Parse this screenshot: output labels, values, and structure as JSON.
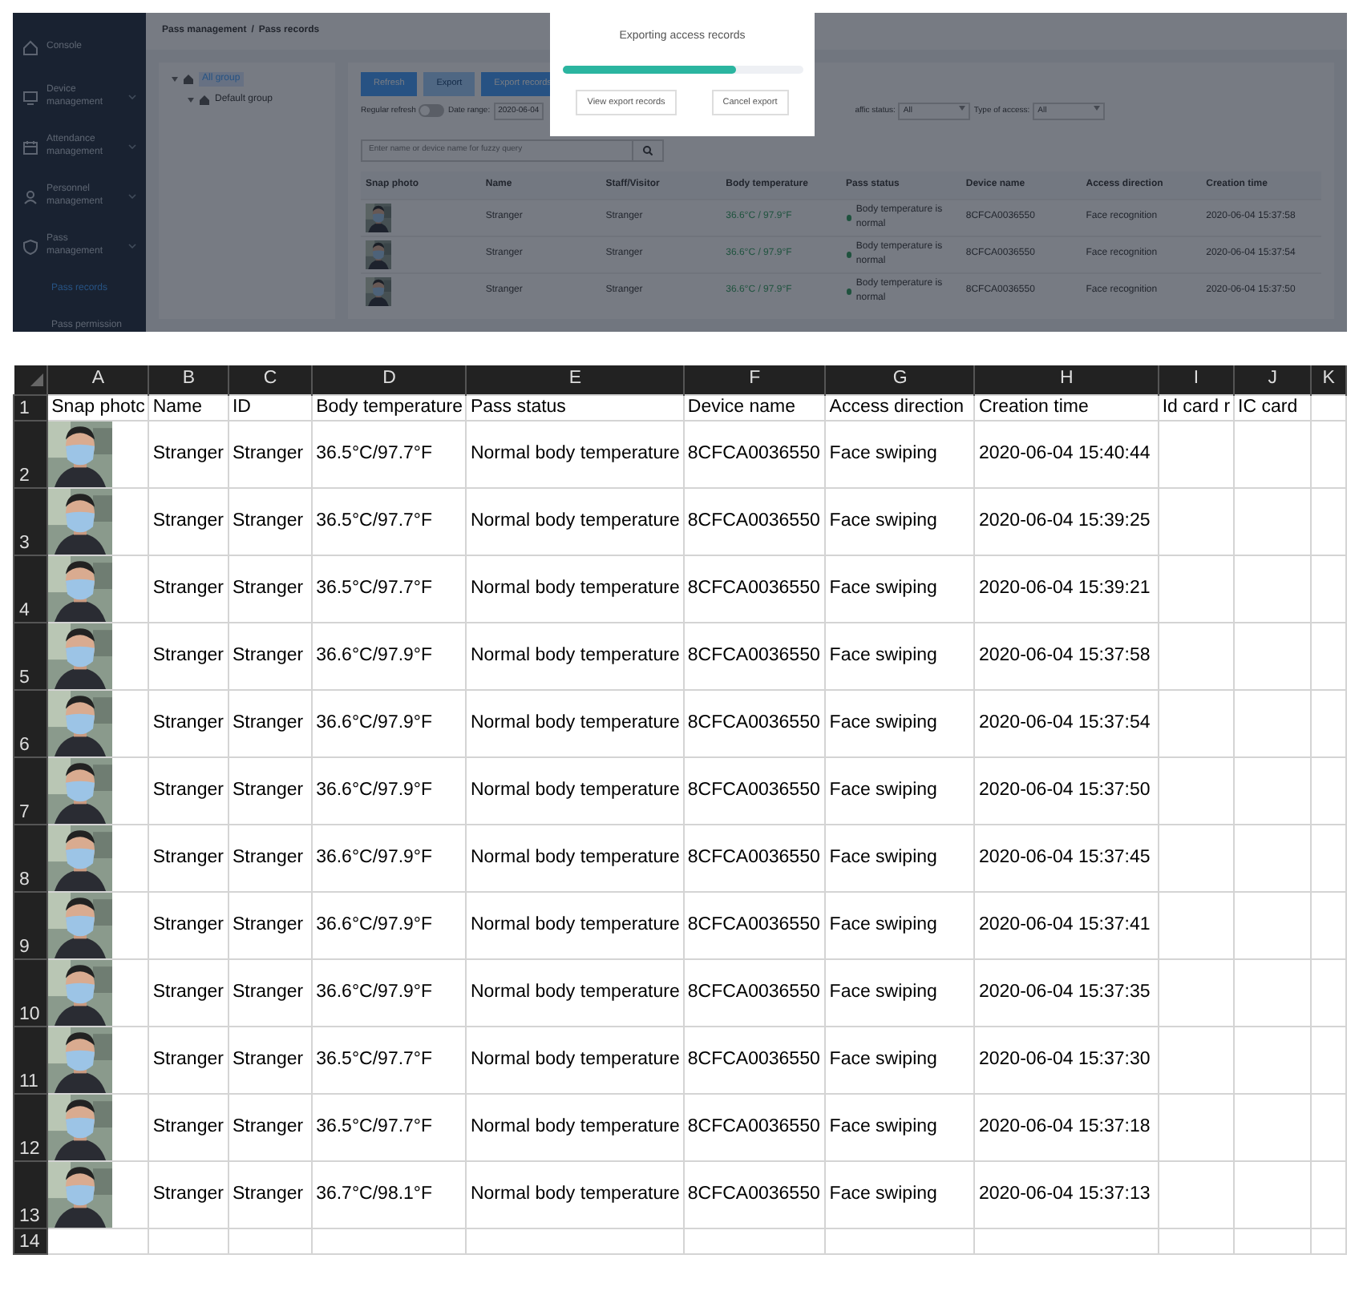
{
  "app": {
    "sidebar": {
      "items": [
        {
          "label": "Console",
          "kind": "link"
        },
        {
          "label": "Device management",
          "kind": "menu"
        },
        {
          "label": "Attendance management",
          "kind": "menu"
        },
        {
          "label": "Personnel management",
          "kind": "menu"
        },
        {
          "label": "Pass management",
          "kind": "menu",
          "children": [
            {
              "label": "Pass records",
              "selected": true
            },
            {
              "label": "Pass permission",
              "selected": false
            }
          ]
        }
      ]
    },
    "breadcrumb": [
      "Pass management",
      "/",
      "Pass records"
    ],
    "tree": [
      {
        "label": "All group",
        "selected": true,
        "children": [
          {
            "label": "Default group",
            "selected": false
          }
        ]
      }
    ],
    "toolbar": [
      {
        "label": "Refresh",
        "disabled": false
      },
      {
        "label": "Export",
        "disabled": true
      },
      {
        "label": "Export records",
        "disabled": false
      }
    ],
    "filters": {
      "regular_refresh": {
        "label": "Regular refresh",
        "on": false
      },
      "date_label": "Date range:",
      "date_value": "2020-06-04",
      "traffic_label": "affic status:",
      "traffic_value": "All",
      "access_label": "Type of access:",
      "access_value": "All"
    },
    "search": {
      "placeholder": "Enter name or device name for fuzzy query"
    },
    "table": {
      "columns": [
        "Snap photo",
        "Name",
        "Staff/Visitor",
        "Body temperature",
        "Pass status",
        "Device name",
        "Access direction",
        "Creation time"
      ],
      "rows": [
        {
          "name": "Stranger",
          "staff_visitor": "Stranger",
          "temperature": "36.6°C / 97.9°F",
          "status": "Body temperature is normal",
          "device": "8CFCA0036550",
          "direction": "Face recognition",
          "time": "2020-06-04 15:37:58"
        },
        {
          "name": "Stranger",
          "staff_visitor": "Stranger",
          "temperature": "36.6°C / 97.9°F",
          "status": "Body temperature is normal",
          "device": "8CFCA0036550",
          "direction": "Face recognition",
          "time": "2020-06-04 15:37:54"
        },
        {
          "name": "Stranger",
          "staff_visitor": "Stranger",
          "temperature": "36.6°C / 97.9°F",
          "status": "Body temperature is normal",
          "device": "8CFCA0036550",
          "direction": "Face recognition",
          "time": "2020-06-04 15:37:50"
        }
      ]
    },
    "modal": {
      "title": "Exporting access records",
      "level": 0.72,
      "buttons": [
        "View export records",
        "Cancel export"
      ]
    }
  },
  "spreadsheet": {
    "column_letters": [
      "A",
      "B",
      "C",
      "D",
      "E",
      "F",
      "G",
      "H",
      "I",
      "J",
      "K"
    ],
    "row_numbers": [
      "1",
      "2",
      "3",
      "4",
      "5",
      "6",
      "7",
      "8",
      "9",
      "10",
      "11",
      "12",
      "13",
      "14"
    ],
    "header": [
      "Snap photc",
      "Name",
      "ID",
      "Body temperature",
      "Pass status",
      "Device name",
      "Access direction",
      "Creation time",
      "Id card r",
      "IC card"
    ],
    "rows": [
      {
        "name": "Stranger",
        "id": "Stranger",
        "temperature": "36.5°C/97.7°F",
        "status": "Normal body temperature",
        "device": "8CFCA0036550",
        "direction": "Face swiping",
        "time": "2020-06-04 15:40:44"
      },
      {
        "name": "Stranger",
        "id": "Stranger",
        "temperature": "36.5°C/97.7°F",
        "status": "Normal body temperature",
        "device": "8CFCA0036550",
        "direction": "Face swiping",
        "time": "2020-06-04 15:39:25"
      },
      {
        "name": "Stranger",
        "id": "Stranger",
        "temperature": "36.5°C/97.7°F",
        "status": "Normal body temperature",
        "device": "8CFCA0036550",
        "direction": "Face swiping",
        "time": "2020-06-04 15:39:21"
      },
      {
        "name": "Stranger",
        "id": "Stranger",
        "temperature": "36.6°C/97.9°F",
        "status": "Normal body temperature",
        "device": "8CFCA0036550",
        "direction": "Face swiping",
        "time": "2020-06-04 15:37:58"
      },
      {
        "name": "Stranger",
        "id": "Stranger",
        "temperature": "36.6°C/97.9°F",
        "status": "Normal body temperature",
        "device": "8CFCA0036550",
        "direction": "Face swiping",
        "time": "2020-06-04 15:37:54"
      },
      {
        "name": "Stranger",
        "id": "Stranger",
        "temperature": "36.6°C/97.9°F",
        "status": "Normal body temperature",
        "device": "8CFCA0036550",
        "direction": "Face swiping",
        "time": "2020-06-04 15:37:50"
      },
      {
        "name": "Stranger",
        "id": "Stranger",
        "temperature": "36.6°C/97.9°F",
        "status": "Normal body temperature",
        "device": "8CFCA0036550",
        "direction": "Face swiping",
        "time": "2020-06-04 15:37:45"
      },
      {
        "name": "Stranger",
        "id": "Stranger",
        "temperature": "36.6°C/97.9°F",
        "status": "Normal body temperature",
        "device": "8CFCA0036550",
        "direction": "Face swiping",
        "time": "2020-06-04 15:37:41"
      },
      {
        "name": "Stranger",
        "id": "Stranger",
        "temperature": "36.6°C/97.9°F",
        "status": "Normal body temperature",
        "device": "8CFCA0036550",
        "direction": "Face swiping",
        "time": "2020-06-04 15:37:35"
      },
      {
        "name": "Stranger",
        "id": "Stranger",
        "temperature": "36.5°C/97.7°F",
        "status": "Normal body temperature",
        "device": "8CFCA0036550",
        "direction": "Face swiping",
        "time": "2020-06-04 15:37:30"
      },
      {
        "name": "Stranger",
        "id": "Stranger",
        "temperature": "36.5°C/97.7°F",
        "status": "Normal body temperature",
        "device": "8CFCA0036550",
        "direction": "Face swiping",
        "time": "2020-06-04 15:37:18"
      },
      {
        "name": "Stranger",
        "id": "Stranger",
        "temperature": "36.7°C/98.1°F",
        "status": "Normal body temperature",
        "device": "8CFCA0036550",
        "direction": "Face swiping",
        "time": "2020-06-04 15:37:13"
      }
    ]
  }
}
